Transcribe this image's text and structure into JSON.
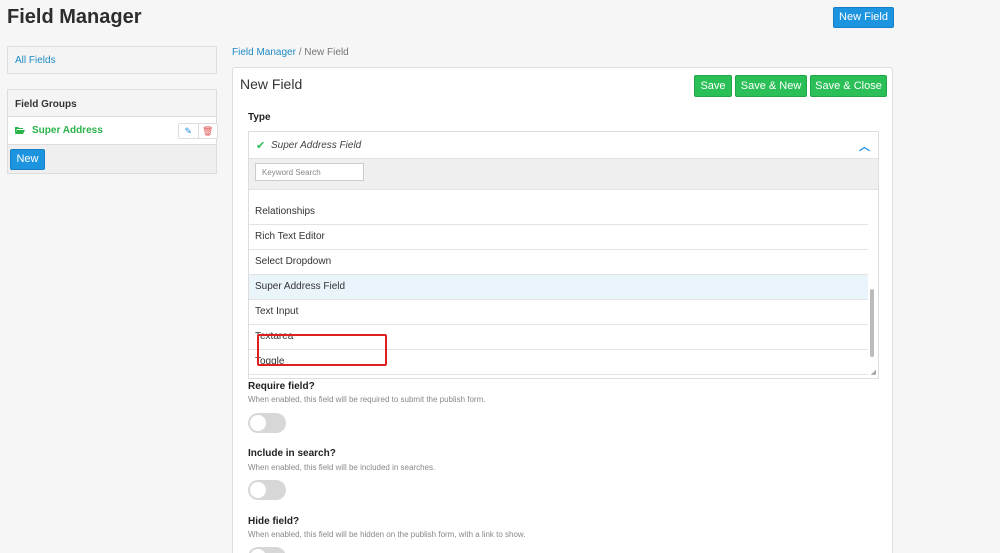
{
  "page": {
    "title": "Field Manager",
    "new_field_button": "New Field"
  },
  "sidebar": {
    "all_fields": "All Fields",
    "field_groups_header": "Field Groups",
    "groups": [
      {
        "label": "Super Address"
      }
    ],
    "new_button": "New"
  },
  "breadcrumb": {
    "parent": "Field Manager",
    "separator": "/",
    "current": "New Field"
  },
  "form": {
    "title": "New Field",
    "buttons": {
      "save": "Save",
      "save_new": "Save & New",
      "save_close": "Save & Close"
    },
    "type": {
      "label": "Type",
      "selected": "Super Address Field",
      "search_placeholder": "Keyword Search",
      "options": [
        "Relationships",
        "Rich Text Editor",
        "Select Dropdown",
        "Super Address Field",
        "Text Input",
        "Textarea",
        "Toggle"
      ]
    },
    "require": {
      "label": "Require field?",
      "help": "When enabled, this field will be required to submit the publish form."
    },
    "search": {
      "label": "Include in search?",
      "help": "When enabled, this field will be included in searches."
    },
    "hide": {
      "label": "Hide field?",
      "help": "When enabled, this field will be hidden on the publish form, with a link to show."
    }
  },
  "colors": {
    "accent_blue": "#1d94e0",
    "accent_green": "#2bbf57",
    "highlight_red": "#e02020"
  }
}
